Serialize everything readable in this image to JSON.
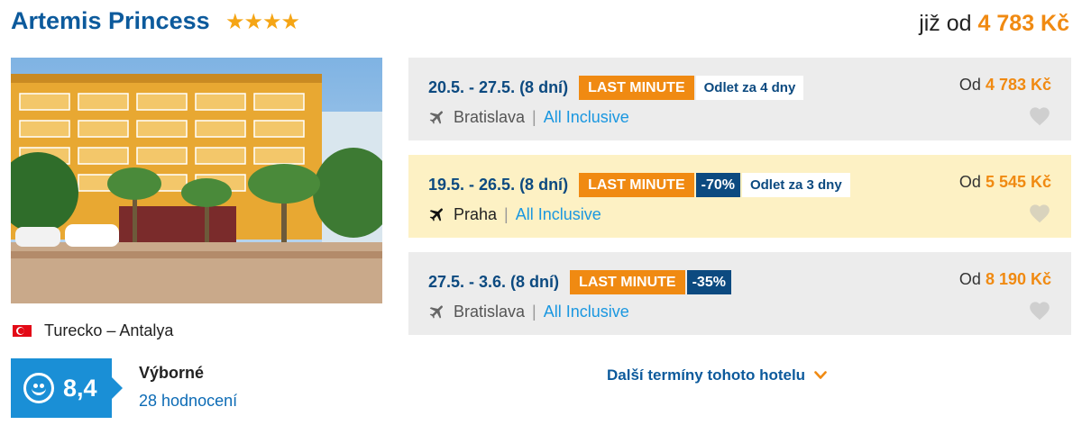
{
  "hotel": {
    "name": "Artemis Princess",
    "stars": "★★★★",
    "star_count": 4,
    "price_prefix": "již od",
    "price": "4 783 Kč"
  },
  "location": {
    "flag": "flag-turkey",
    "text": "Turecko – Antalya"
  },
  "rating": {
    "value": "8,4",
    "label": "Výborné",
    "count": "28 hodnocení"
  },
  "offers": [
    {
      "dates": "20.5. - 27.5. (8 dní)",
      "tags": {
        "last_minute": "LAST MINUTE",
        "discount": "",
        "departure": "Odlet za 4 dny"
      },
      "city": "Bratislava",
      "board": "All Inclusive",
      "price_prefix": "Od",
      "price": "4 783 Kč",
      "highlight": false
    },
    {
      "dates": "19.5. - 26.5. (8 dní)",
      "tags": {
        "last_minute": "LAST MINUTE",
        "discount": "-70%",
        "departure": "Odlet za 3 dny"
      },
      "city": "Praha",
      "board": "All Inclusive",
      "price_prefix": "Od",
      "price": "5 545 Kč",
      "highlight": true
    },
    {
      "dates": "27.5. - 3.6. (8 dní)",
      "tags": {
        "last_minute": "LAST MINUTE",
        "discount": "-35%",
        "departure": ""
      },
      "city": "Bratislava",
      "board": "All Inclusive",
      "price_prefix": "Od",
      "price": "8 190 Kč",
      "highlight": false
    }
  ],
  "more_link": "Další termíny tohoto hotelu",
  "colors": {
    "brand_blue": "#0c5a9c",
    "accent_orange": "#f08a12",
    "rating_blue": "#1a8fd6",
    "highlight_bg": "#fdf1c4",
    "offer_bg": "#ececec"
  },
  "icons": {
    "plane": "plane-icon",
    "heart": "heart-icon",
    "smiley": "smiley-icon",
    "chevron": "chevron-down-icon"
  }
}
